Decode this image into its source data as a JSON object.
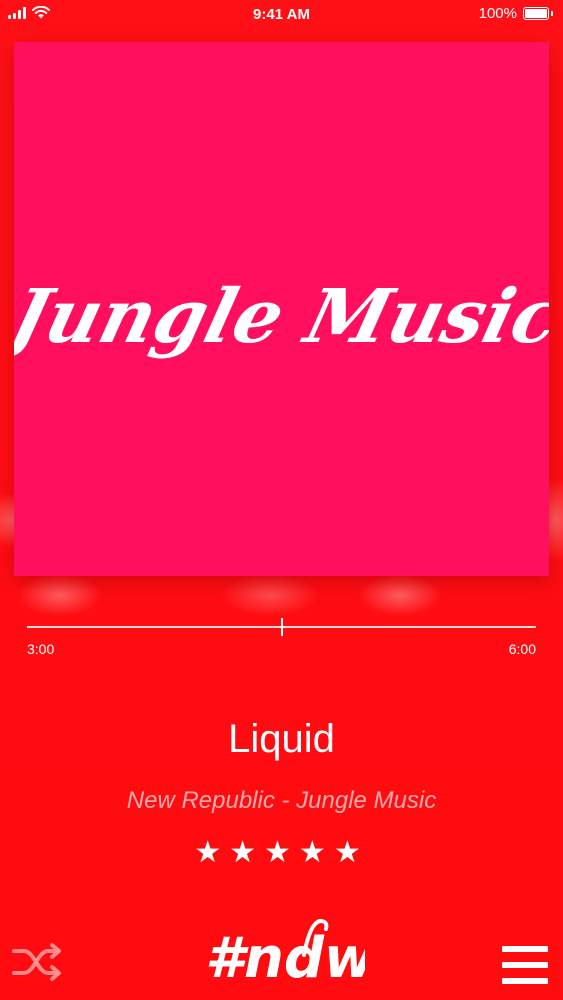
{
  "status_bar": {
    "time": "9:41 AM",
    "battery": "100%"
  },
  "album": {
    "art_text": "Jungle Music",
    "background": "#ff0f5e"
  },
  "player": {
    "elapsed": "3:00",
    "total": "6:00",
    "progress_fraction": 0.5,
    "title": "Liquid",
    "subtitle": "New Republic - Jungle Music",
    "rating_stars": 5,
    "rating_display": "★★★★★"
  },
  "footer": {
    "logo_text": "#ndw",
    "shuffle_icon": "shuffle-icon",
    "menu_icon": "hamburger-menu-icon"
  },
  "colors": {
    "background": "#ff0d12",
    "text": "#ffffff"
  }
}
